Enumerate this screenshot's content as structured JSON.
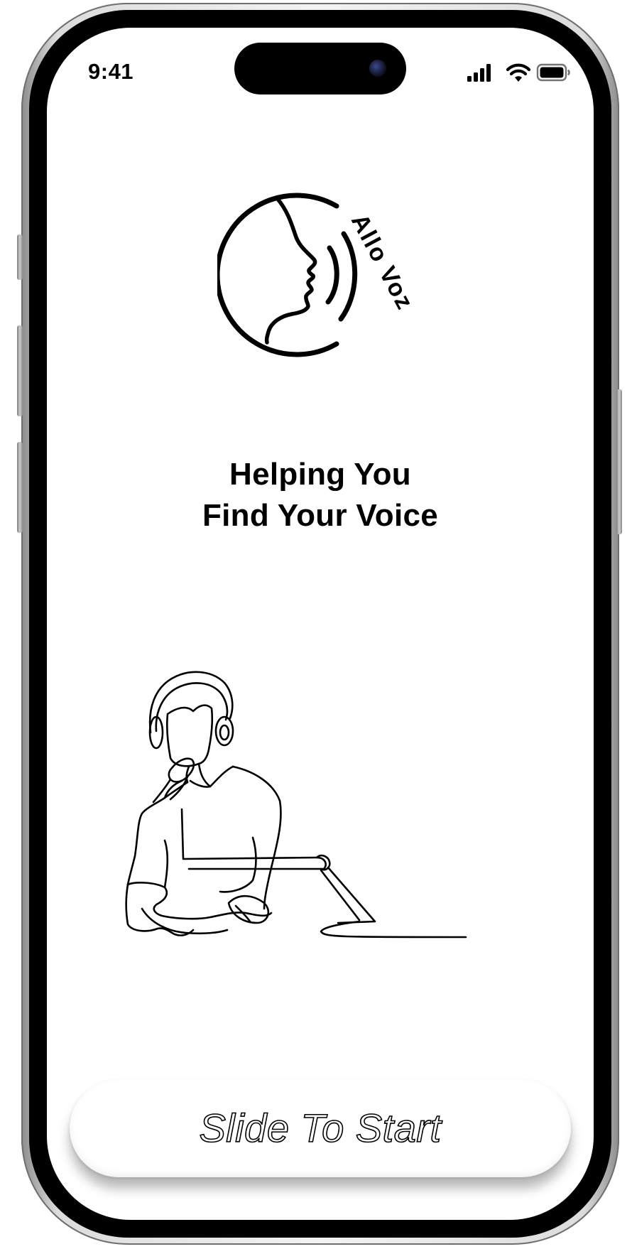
{
  "status_bar": {
    "time": "9:41",
    "icons": [
      "cellular-signal-icon",
      "wifi-icon",
      "battery-icon"
    ]
  },
  "logo": {
    "brand_text": "Allo Voz",
    "icon": "speaking-head-icon"
  },
  "headline": {
    "line1": "Helping You",
    "line2": "Find Your Voice"
  },
  "illustration": {
    "icon": "podcaster-line-art-icon"
  },
  "slide_button": {
    "label": "Slide To Start"
  },
  "colors": {
    "foreground": "#000000",
    "background": "#ffffff"
  }
}
